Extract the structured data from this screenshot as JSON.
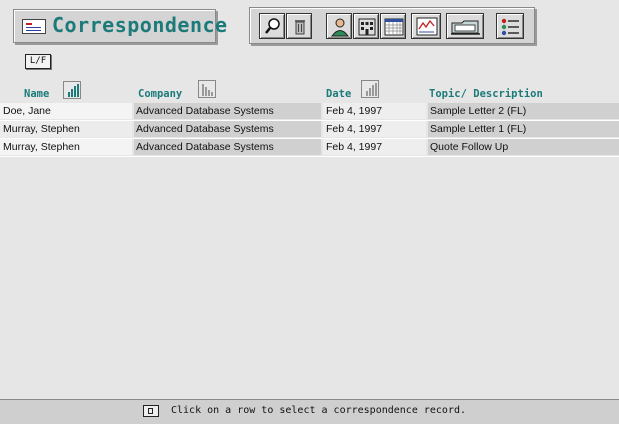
{
  "app": {
    "title": "Correspondence"
  },
  "toolbar": {
    "buttons": [
      {
        "icon": "magnifier-icon"
      },
      {
        "icon": "trash-icon"
      },
      {
        "icon": "person-icon"
      },
      {
        "icon": "building-icon"
      },
      {
        "icon": "calendar-icon"
      },
      {
        "icon": "chart-document-icon"
      },
      {
        "icon": "folder-icon"
      },
      {
        "icon": "list-icon"
      }
    ]
  },
  "lf_button": {
    "label": "L/F"
  },
  "columns": {
    "name": "Name",
    "company": "Company",
    "date": "Date",
    "topic": "Topic/ Description"
  },
  "rows": [
    {
      "name": "Doe, Jane",
      "company": "Advanced Database Systems",
      "date": "Feb 4, 1997",
      "topic": "Sample Letter 2 (FL)"
    },
    {
      "name": "Murray, Stephen",
      "company": "Advanced Database Systems",
      "date": "Feb 4, 1997",
      "topic": "Sample Letter 1 (FL)"
    },
    {
      "name": "Murray, Stephen",
      "company": "Advanced Database Systems",
      "date": "Feb 4, 1997",
      "topic": "Quote Follow Up"
    }
  ],
  "status": {
    "message": "Click on a row to select a correspondence record."
  },
  "colors": {
    "accent": "#1c7a7a",
    "background": "#e6e6e6"
  }
}
